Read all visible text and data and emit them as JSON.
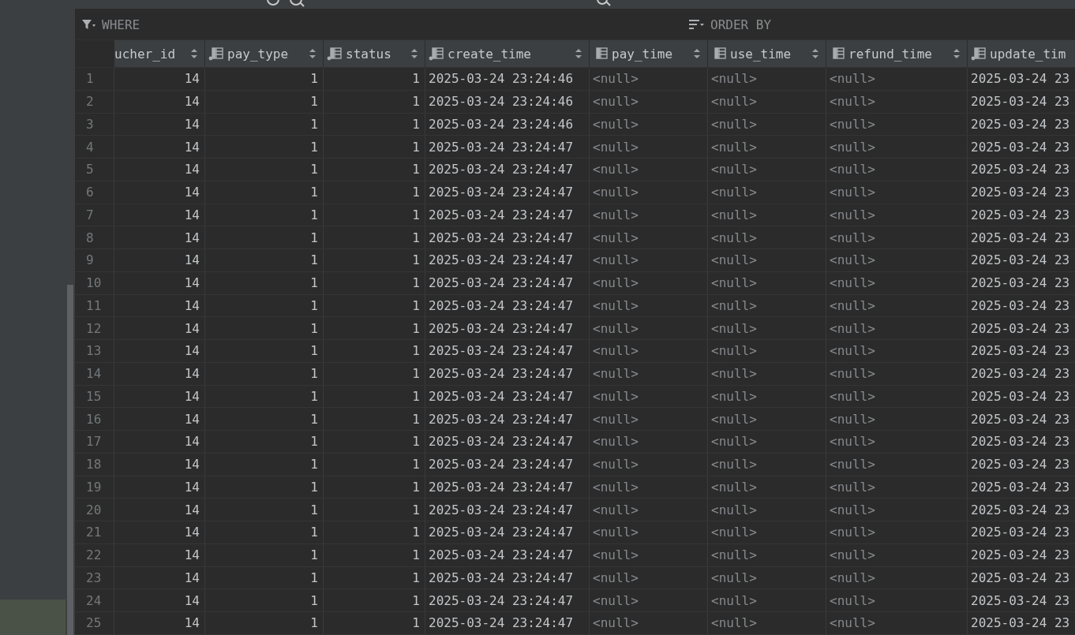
{
  "filter_bar": {
    "where_label": "WHERE",
    "order_label": "ORDER BY"
  },
  "table": {
    "columns": [
      {
        "name": "ucher_id",
        "kind": "number"
      },
      {
        "name": "pay_type",
        "kind": "number",
        "key_dot": true
      },
      {
        "name": "status",
        "kind": "number",
        "key_dot": true
      },
      {
        "name": "create_time",
        "kind": "datetime",
        "key_dot": true
      },
      {
        "name": "pay_time",
        "kind": "empty",
        "key_dot": false
      },
      {
        "name": "use_time",
        "kind": "empty",
        "key_dot": false
      },
      {
        "name": "refund_time",
        "kind": "empty",
        "key_dot": false
      },
      {
        "name": "update_tim",
        "kind": "datetime",
        "key_dot": true
      }
    ],
    "rows": [
      {
        "n": "1",
        "cells": [
          "14",
          "1",
          "1",
          "2025-03-24 23:24:46",
          "<null>",
          "<null>",
          "<null>",
          "2025-03-24 23"
        ]
      },
      {
        "n": "2",
        "cells": [
          "14",
          "1",
          "1",
          "2025-03-24 23:24:46",
          "<null>",
          "<null>",
          "<null>",
          "2025-03-24 23"
        ]
      },
      {
        "n": "3",
        "cells": [
          "14",
          "1",
          "1",
          "2025-03-24 23:24:46",
          "<null>",
          "<null>",
          "<null>",
          "2025-03-24 23"
        ]
      },
      {
        "n": "4",
        "cells": [
          "14",
          "1",
          "1",
          "2025-03-24 23:24:47",
          "<null>",
          "<null>",
          "<null>",
          "2025-03-24 23"
        ]
      },
      {
        "n": "5",
        "cells": [
          "14",
          "1",
          "1",
          "2025-03-24 23:24:47",
          "<null>",
          "<null>",
          "<null>",
          "2025-03-24 23"
        ]
      },
      {
        "n": "6",
        "cells": [
          "14",
          "1",
          "1",
          "2025-03-24 23:24:47",
          "<null>",
          "<null>",
          "<null>",
          "2025-03-24 23"
        ]
      },
      {
        "n": "7",
        "cells": [
          "14",
          "1",
          "1",
          "2025-03-24 23:24:47",
          "<null>",
          "<null>",
          "<null>",
          "2025-03-24 23"
        ]
      },
      {
        "n": "8",
        "cells": [
          "14",
          "1",
          "1",
          "2025-03-24 23:24:47",
          "<null>",
          "<null>",
          "<null>",
          "2025-03-24 23"
        ]
      },
      {
        "n": "9",
        "cells": [
          "14",
          "1",
          "1",
          "2025-03-24 23:24:47",
          "<null>",
          "<null>",
          "<null>",
          "2025-03-24 23"
        ]
      },
      {
        "n": "10",
        "cells": [
          "14",
          "1",
          "1",
          "2025-03-24 23:24:47",
          "<null>",
          "<null>",
          "<null>",
          "2025-03-24 23"
        ]
      },
      {
        "n": "11",
        "cells": [
          "14",
          "1",
          "1",
          "2025-03-24 23:24:47",
          "<null>",
          "<null>",
          "<null>",
          "2025-03-24 23"
        ]
      },
      {
        "n": "12",
        "cells": [
          "14",
          "1",
          "1",
          "2025-03-24 23:24:47",
          "<null>",
          "<null>",
          "<null>",
          "2025-03-24 23"
        ]
      },
      {
        "n": "13",
        "cells": [
          "14",
          "1",
          "1",
          "2025-03-24 23:24:47",
          "<null>",
          "<null>",
          "<null>",
          "2025-03-24 23"
        ]
      },
      {
        "n": "14",
        "cells": [
          "14",
          "1",
          "1",
          "2025-03-24 23:24:47",
          "<null>",
          "<null>",
          "<null>",
          "2025-03-24 23"
        ]
      },
      {
        "n": "15",
        "cells": [
          "14",
          "1",
          "1",
          "2025-03-24 23:24:47",
          "<null>",
          "<null>",
          "<null>",
          "2025-03-24 23"
        ]
      },
      {
        "n": "16",
        "cells": [
          "14",
          "1",
          "1",
          "2025-03-24 23:24:47",
          "<null>",
          "<null>",
          "<null>",
          "2025-03-24 23"
        ]
      },
      {
        "n": "17",
        "cells": [
          "14",
          "1",
          "1",
          "2025-03-24 23:24:47",
          "<null>",
          "<null>",
          "<null>",
          "2025-03-24 23"
        ]
      },
      {
        "n": "18",
        "cells": [
          "14",
          "1",
          "1",
          "2025-03-24 23:24:47",
          "<null>",
          "<null>",
          "<null>",
          "2025-03-24 23"
        ]
      },
      {
        "n": "19",
        "cells": [
          "14",
          "1",
          "1",
          "2025-03-24 23:24:47",
          "<null>",
          "<null>",
          "<null>",
          "2025-03-24 23"
        ]
      },
      {
        "n": "20",
        "cells": [
          "14",
          "1",
          "1",
          "2025-03-24 23:24:47",
          "<null>",
          "<null>",
          "<null>",
          "2025-03-24 23"
        ]
      },
      {
        "n": "21",
        "cells": [
          "14",
          "1",
          "1",
          "2025-03-24 23:24:47",
          "<null>",
          "<null>",
          "<null>",
          "2025-03-24 23"
        ]
      },
      {
        "n": "22",
        "cells": [
          "14",
          "1",
          "1",
          "2025-03-24 23:24:47",
          "<null>",
          "<null>",
          "<null>",
          "2025-03-24 23"
        ]
      },
      {
        "n": "23",
        "cells": [
          "14",
          "1",
          "1",
          "2025-03-24 23:24:47",
          "<null>",
          "<null>",
          "<null>",
          "2025-03-24 23"
        ]
      },
      {
        "n": "24",
        "cells": [
          "14",
          "1",
          "1",
          "2025-03-24 23:24:47",
          "<null>",
          "<null>",
          "<null>",
          "2025-03-24 23"
        ]
      },
      {
        "n": "25",
        "cells": [
          "14",
          "1",
          "1",
          "2025-03-24 23:24:47",
          "<null>",
          "<null>",
          "<null>",
          "2025-03-24 23"
        ]
      }
    ]
  }
}
